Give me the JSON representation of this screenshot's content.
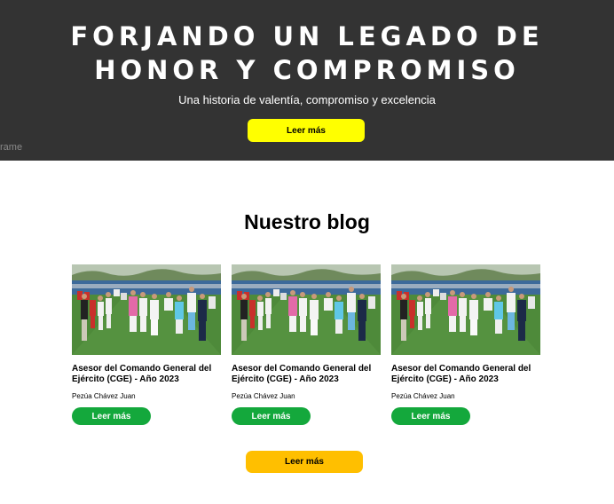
{
  "hero": {
    "title_line1": "FORJANDO UN LEGADO DE",
    "title_line2": "HONOR Y COMPROMISO",
    "subtitle": "Una historia de valentía, compromiso y excelencia",
    "button_label": "Leer más",
    "frame_label": "rame",
    "bg_color": "#333333",
    "button_color": "#ffff00"
  },
  "blog": {
    "heading": "Nuestro blog",
    "posts": [
      {
        "title": "Asesor del Comando General del Ejército (CGE) - Año 2023",
        "author": "Pezúa Chávez Juan",
        "button_label": "Leer más",
        "image": "team-photo"
      },
      {
        "title": "Asesor del Comando General del Ejército (CGE) - Año 2023",
        "author": "Pezúa Chávez Juan",
        "button_label": "Leer más",
        "image": "team-photo"
      },
      {
        "title": "Asesor del Comando General del Ejército (CGE) - Año 2023",
        "author": "Pezúa Chávez Juan",
        "button_label": "Leer más",
        "image": "team-photo"
      }
    ],
    "more_button_label": "Leer más",
    "post_button_color": "#14a83c",
    "more_button_color": "#ffbf00"
  }
}
